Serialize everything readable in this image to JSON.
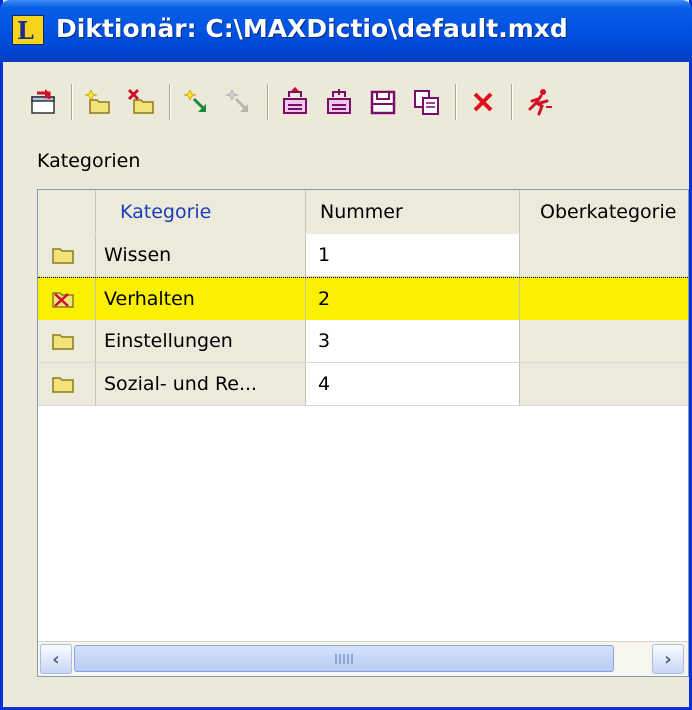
{
  "window": {
    "title": "Diktionär: C:\\MAXDictio\\default.mxd",
    "app_icon_letter": "L"
  },
  "toolbar": {
    "buttons": [
      {
        "name": "export-icon"
      },
      {
        "name": "new-category-icon"
      },
      {
        "name": "delete-category-icon"
      },
      {
        "name": "new-word-icon"
      },
      {
        "name": "delete-word-icon"
      },
      {
        "name": "open-icon"
      },
      {
        "name": "import-icon"
      },
      {
        "name": "save-icon"
      },
      {
        "name": "copy-icon"
      },
      {
        "name": "delete-icon"
      },
      {
        "name": "run-icon"
      }
    ]
  },
  "section_label": "Kategorien",
  "table": {
    "columns": [
      "Kategorie",
      "Nummer",
      "Oberkategorie"
    ],
    "rows": [
      {
        "kategorie": "Wissen",
        "nummer": "1",
        "oberkategorie": "",
        "selected": false
      },
      {
        "kategorie": "Verhalten",
        "nummer": "2",
        "oberkategorie": "",
        "selected": true
      },
      {
        "kategorie": "Einstellungen",
        "nummer": "3",
        "oberkategorie": "",
        "selected": false
      },
      {
        "kategorie": "Sozial- und Re...",
        "nummer": "4",
        "oberkategorie": "",
        "selected": false
      }
    ]
  },
  "colors": {
    "selection": "#fbf000",
    "title_bar": "#0054e3",
    "sorted_header": "#1d3db8"
  }
}
